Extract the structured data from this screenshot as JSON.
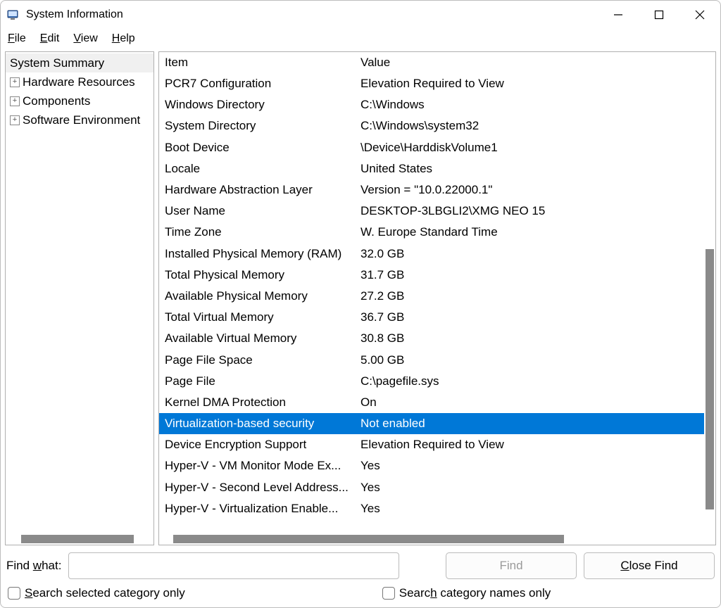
{
  "window": {
    "title": "System Information"
  },
  "menu": {
    "file": "File",
    "edit": "Edit",
    "view": "View",
    "help": "Help"
  },
  "tree": {
    "items": [
      {
        "label": "System Summary",
        "selected": true,
        "expandable": false
      },
      {
        "label": "Hardware Resources",
        "selected": false,
        "expandable": true
      },
      {
        "label": "Components",
        "selected": false,
        "expandable": true
      },
      {
        "label": "Software Environment",
        "selected": false,
        "expandable": true
      }
    ]
  },
  "table": {
    "header_item": "Item",
    "header_value": "Value",
    "rows": [
      {
        "item": "PCR7 Configuration",
        "value": "Elevation Required to View",
        "selected": false
      },
      {
        "item": "Windows Directory",
        "value": "C:\\Windows",
        "selected": false
      },
      {
        "item": "System Directory",
        "value": "C:\\Windows\\system32",
        "selected": false
      },
      {
        "item": "Boot Device",
        "value": "\\Device\\HarddiskVolume1",
        "selected": false
      },
      {
        "item": "Locale",
        "value": "United States",
        "selected": false
      },
      {
        "item": "Hardware Abstraction Layer",
        "value": "Version = \"10.0.22000.1\"",
        "selected": false
      },
      {
        "item": "User Name",
        "value": "DESKTOP-3LBGLI2\\XMG NEO 15",
        "selected": false
      },
      {
        "item": "Time Zone",
        "value": "W. Europe Standard Time",
        "selected": false
      },
      {
        "item": "Installed Physical Memory (RAM)",
        "value": "32.0 GB",
        "selected": false
      },
      {
        "item": "Total Physical Memory",
        "value": "31.7 GB",
        "selected": false
      },
      {
        "item": "Available Physical Memory",
        "value": "27.2 GB",
        "selected": false
      },
      {
        "item": "Total Virtual Memory",
        "value": "36.7 GB",
        "selected": false
      },
      {
        "item": "Available Virtual Memory",
        "value": "30.8 GB",
        "selected": false
      },
      {
        "item": "Page File Space",
        "value": "5.00 GB",
        "selected": false
      },
      {
        "item": "Page File",
        "value": "C:\\pagefile.sys",
        "selected": false
      },
      {
        "item": "Kernel DMA Protection",
        "value": "On",
        "selected": false
      },
      {
        "item": "Virtualization-based security",
        "value": "Not enabled",
        "selected": true
      },
      {
        "item": "Device Encryption Support",
        "value": "Elevation Required to View",
        "selected": false
      },
      {
        "item": "Hyper-V - VM Monitor Mode Ex...",
        "value": "Yes",
        "selected": false
      },
      {
        "item": "Hyper-V - Second Level Address...",
        "value": "Yes",
        "selected": false
      },
      {
        "item": "Hyper-V - Virtualization Enable...",
        "value": "Yes",
        "selected": false
      }
    ]
  },
  "find": {
    "label": "Find what:",
    "value": "",
    "find_btn": "Find",
    "close_btn": "Close Find",
    "chk_selected": "Search selected category only",
    "chk_names": "Search category names only"
  }
}
